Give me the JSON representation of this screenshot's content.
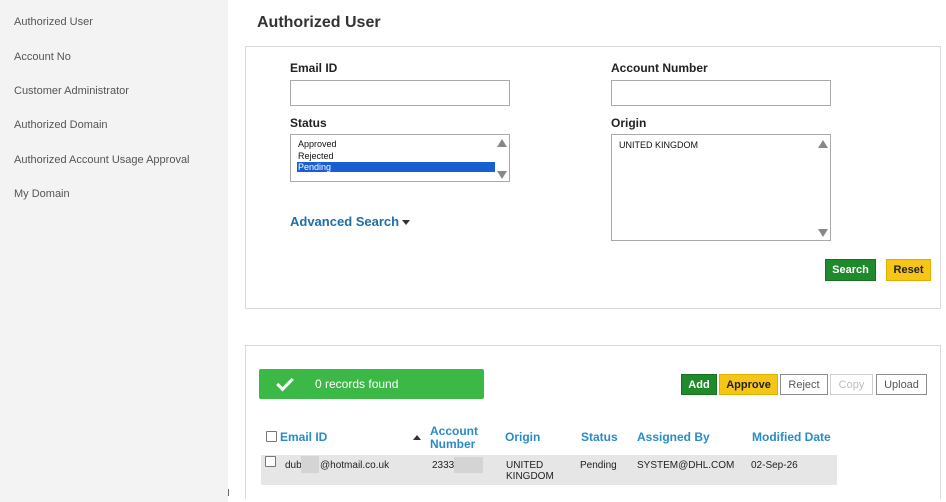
{
  "sidebar": {
    "items": [
      {
        "label": "Authorized User"
      },
      {
        "label": "Account No"
      },
      {
        "label": "Customer Administrator"
      },
      {
        "label": "Authorized Domain"
      },
      {
        "label": "Authorized Account Usage Approval"
      },
      {
        "label": "My Domain"
      }
    ]
  },
  "page": {
    "title": "Authorized User"
  },
  "search": {
    "email_label": "Email ID",
    "email_value": "",
    "account_label": "Account Number",
    "account_value": "",
    "status_label": "Status",
    "status_options": [
      "Approved",
      "Rejected",
      "Pending"
    ],
    "status_selected": "Pending",
    "origin_label": "Origin",
    "origin_options": [
      "UNITED KINGDOM"
    ],
    "advanced_search_label": "Advanced Search",
    "search_button": "Search",
    "reset_button": "Reset"
  },
  "results": {
    "records_text": "0 records found",
    "actions": {
      "add": "Add",
      "approve": "Approve",
      "reject": "Reject",
      "copy": "Copy",
      "upload": "Upload"
    },
    "columns": {
      "email": "Email ID",
      "account_line1": "Account",
      "account_line2": "Number",
      "origin": "Origin",
      "status": "Status",
      "assigned_by": "Assigned By",
      "modified_date": "Modified Date"
    },
    "rows": [
      {
        "email_prefix": "dub",
        "email_suffix": "@hotmail.co.uk",
        "account": "2333",
        "origin_line1": "UNITED",
        "origin_line2": "KINGDOM",
        "status": "Pending",
        "assigned_by": "SYSTEM@DHL.COM",
        "modified_date": "02-Sep-26"
      }
    ]
  },
  "colors": {
    "primary_green": "#1f8a2b",
    "banner_green": "#3cb846",
    "accent_yellow": "#f5c518",
    "link_blue": "#1e6ea8",
    "column_blue": "#2a8bc9",
    "selection_blue": "#1a5fd2"
  }
}
